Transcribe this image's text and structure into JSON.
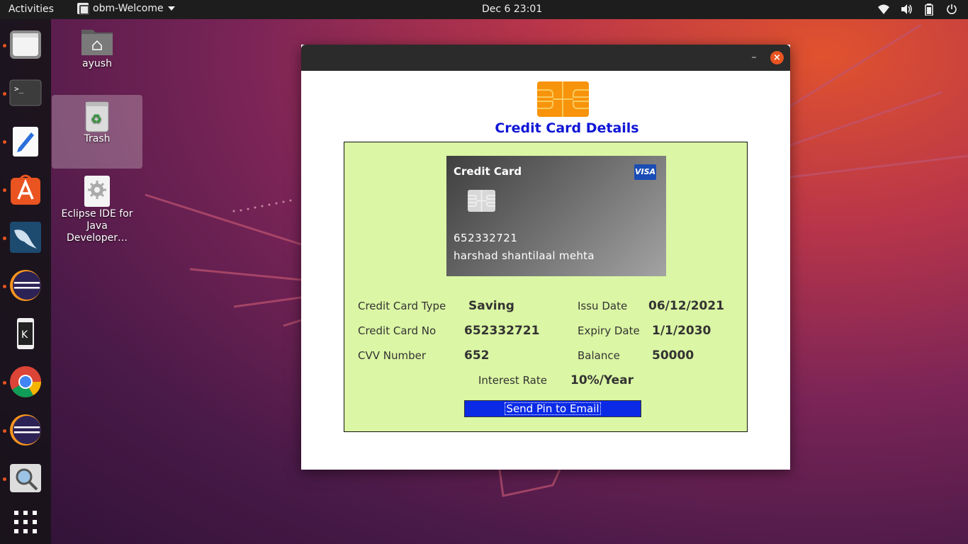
{
  "topbar": {
    "activities": "Activities",
    "app_menu": "obm-Welcome",
    "clock": "Dec 6  23:01",
    "tray_icons": [
      "wifi-icon",
      "volume-icon",
      "battery-icon",
      "power-menu-icon"
    ]
  },
  "dock": {
    "items": [
      "files",
      "terminal",
      "text-editor",
      "software-center",
      "mysql-workbench",
      "eclipse",
      "kde-connect",
      "chrome",
      "eclipse",
      "image-viewer",
      "show-applications"
    ]
  },
  "desktop": {
    "icons": [
      {
        "label": "ayush",
        "icon": "home-folder-icon"
      },
      {
        "label": "Trash",
        "icon": "trash-icon"
      },
      {
        "label": "Eclipse IDE for Java Developer…",
        "icon": "eclipse-launcher-icon"
      }
    ]
  },
  "dialog": {
    "title": "Credit Card Details",
    "minimize": "–",
    "close": "×",
    "card": {
      "label": "Credit Card",
      "brand": "VISA",
      "number": "652332721",
      "holder": "harshad shantilaal mehta"
    },
    "fields": {
      "type_label": "Credit Card Type",
      "type_value": "Saving",
      "number_label": "Credit Card No",
      "number_value": "652332721",
      "cvv_label": "CVV Number",
      "cvv_value": "652",
      "issue_label": "Issu Date",
      "issue_value": "06/12/2021",
      "expiry_label": "Expiry Date",
      "expiry_value": "1/1/2030",
      "balance_label": "Balance",
      "balance_value": "50000",
      "interest_label": "Interest Rate",
      "interest_value": "10%/Year"
    },
    "send_button": "Send Pin to Email"
  },
  "colors": {
    "title_blue": "#1016d6",
    "panel_green": "#dbf6a4",
    "button_blue": "#0a2ae6",
    "ubuntu_orange": "#e95420"
  }
}
